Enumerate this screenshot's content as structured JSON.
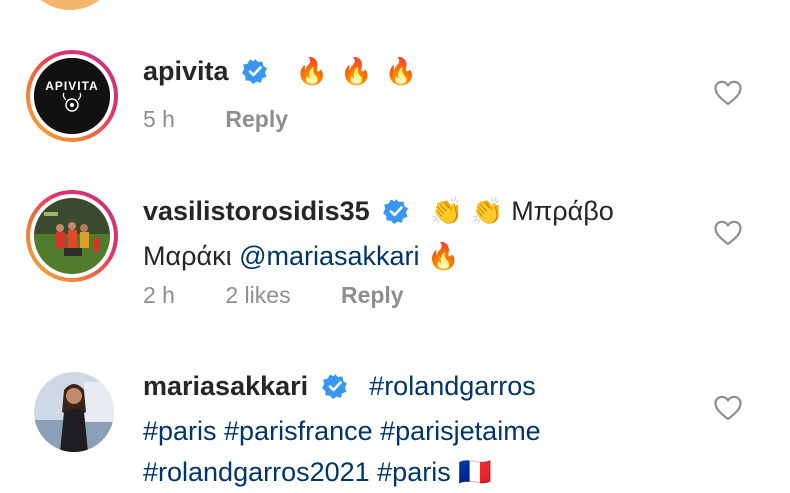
{
  "comments": [
    {
      "username": "apivita",
      "emojis": "🔥 🔥 🔥",
      "time": "5 h",
      "reply_label": "Reply",
      "avatar_logo": "APIVITA"
    },
    {
      "username": "vasilistorosidis35",
      "emojis": "👏 👏",
      "text_1": "Μπράβο",
      "text_2": "Μαράκι",
      "mention": "@mariasakkari",
      "trailing_emoji": "🔥",
      "time": "2 h",
      "likes": "2 likes",
      "reply_label": "Reply"
    },
    {
      "username": "mariasakkari",
      "tags_line1": "#rolandgarros",
      "tags_line2": "#paris #parisfrance #parisjetaime",
      "tags_line3": "#rolandgarros2021 #paris 🇫🇷"
    }
  ],
  "icons": {
    "verified": "verified-badge-icon",
    "heart": "heart-outline-icon"
  },
  "colors": {
    "verified_blue": "#3897f0",
    "link_blue": "#003569",
    "meta_gray": "#8e8e8e",
    "text": "#262626"
  }
}
